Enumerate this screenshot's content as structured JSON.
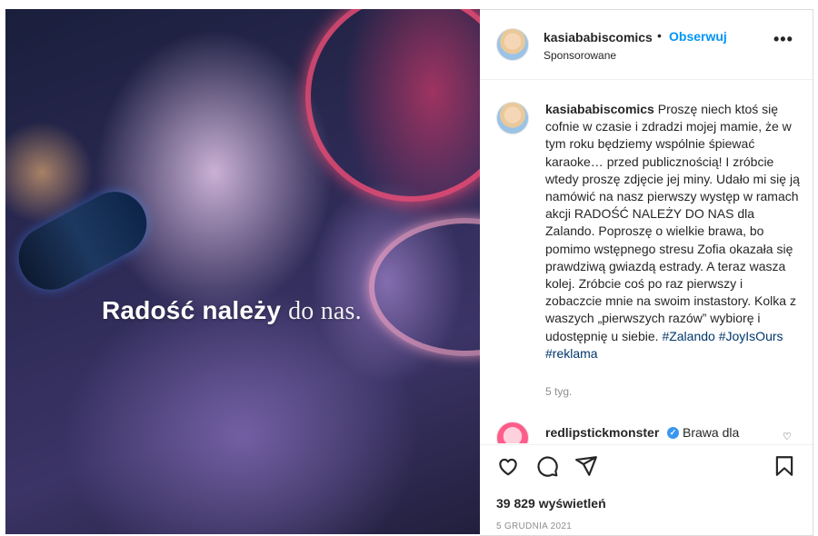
{
  "media": {
    "caption_bold": "Radość należy",
    "caption_light": "do nas."
  },
  "header": {
    "username": "kasiababiscomics",
    "separator": "•",
    "follow_label": "Obserwuj",
    "sponsored": "Sponsorowane",
    "more_label": "•••"
  },
  "post": {
    "username": "kasiababiscomics",
    "text": "Proszę niech ktoś się cofnie w czasie i zdradzi mojej mamie, że w tym roku będziemy wspólnie śpiewać karaoke… przed publicznością! I zróbcie wtedy proszę zdjęcie jej miny. Udało mi się ją namówić na nasz pierwszy występ w ramach akcji RADOŚĆ NALEŻY DO NAS dla Zalando. Poproszę o wielkie brawa, bo pomimo wstępnego stresu Zofia okazała się prawdziwą gwiazdą estrady. A teraz wasza kolej. Zróbcie coś po raz pierwszy i zobaczcie mnie na swoim instastory. Kolka z waszych „pierwszych razów” wybiorę i udostępnię u siebie.",
    "hashtags": [
      "#Zalando",
      "#JoyIsOurs",
      "#reklama"
    ],
    "time": "5 tyg."
  },
  "reply": {
    "username": "redlipstickmonster",
    "verified_mark": "✓",
    "text": "Brawa dla",
    "heart": "♡"
  },
  "actions": {
    "views": "39 829 wyświetleń",
    "date": "5 GRUDNIA 2021"
  },
  "colors": {
    "link": "#0095f6",
    "hashtag": "#00376b",
    "muted": "#8e8e8e",
    "verified": "#3897f0"
  },
  "icons": [
    "heart-icon",
    "comment-icon",
    "share-icon",
    "bookmark-icon",
    "more-icon",
    "verified-icon"
  ]
}
